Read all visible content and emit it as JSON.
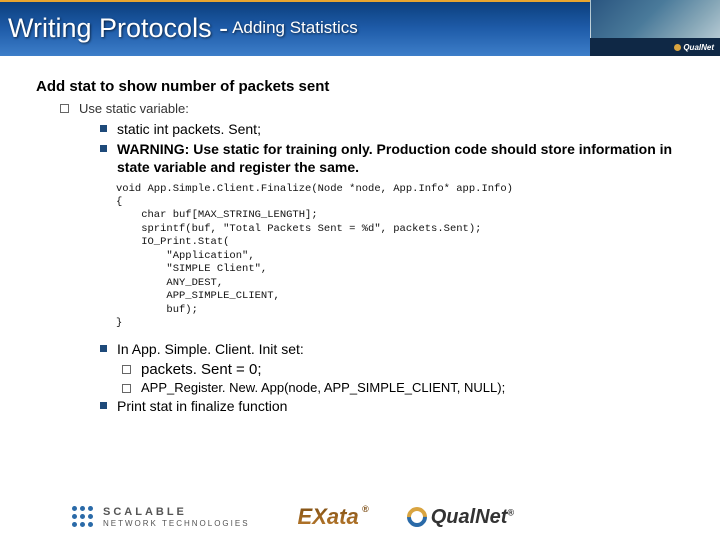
{
  "title": {
    "main": "Writing Protocols - ",
    "sub": "Adding Statistics"
  },
  "heading": "Add stat to show number of packets sent",
  "l1_text": "Use static variable:",
  "bullets": {
    "b1": "static int packets. Sent;",
    "b2": "WARNING: Use static for training only. Production code should store information in state variable and register the same.",
    "b3": "In App. Simple. Client. Init set:",
    "b3a": "packets. Sent = 0;",
    "b3b": "APP_Register. New. App(node, APP_SIMPLE_CLIENT, NULL);",
    "b4": "Print stat in finalize function"
  },
  "code": "void App.Simple.Client.Finalize(Node *node, App.Info* app.Info)\n{\n    char buf[MAX_STRING_LENGTH];\n    sprintf(buf, \"Total Packets Sent = %d\", packets.Sent);\n    IO_Print.Stat(\n        \"Application\",\n        \"SIMPLE Client\",\n        ANY_DEST,\n        APP_SIMPLE_CLIENT,\n        buf);\n}",
  "logos": {
    "scalable_line1": "SCALABLE",
    "scalable_line2": "NETWORK TECHNOLOGIES",
    "exata": "EXata",
    "qualnet": "QualNet",
    "corner": "QualNet"
  }
}
